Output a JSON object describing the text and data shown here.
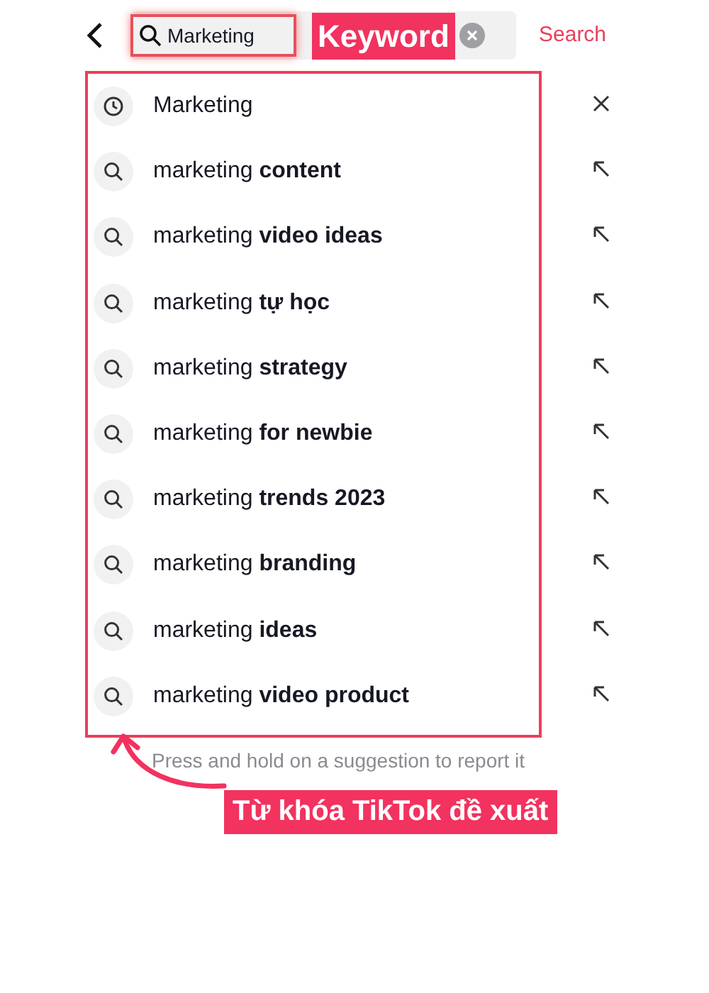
{
  "search_bar": {
    "value": "Marketing",
    "action": "Search"
  },
  "annotations": {
    "keyword_label": "Keyword",
    "suggestions_label": "Từ khóa TikTok đề xuất"
  },
  "suggestions": [
    {
      "kind": "history",
      "text": "Marketing"
    },
    {
      "kind": "suggestion",
      "text": "marketing **content**"
    },
    {
      "kind": "suggestion",
      "text": "marketing **video ideas**"
    },
    {
      "kind": "suggestion",
      "text": "marketing **tự học**"
    },
    {
      "kind": "suggestion",
      "text": "marketing **strategy**"
    },
    {
      "kind": "suggestion",
      "text": "marketing **for newbie**"
    },
    {
      "kind": "suggestion",
      "text": "marketing **trends 2023**"
    },
    {
      "kind": "suggestion",
      "text": "marketing **branding**"
    },
    {
      "kind": "suggestion",
      "text": "marketing **ideas**"
    },
    {
      "kind": "suggestion",
      "text": "marketing **video product**"
    }
  ],
  "hint": "Press and hold on a suggestion to report it"
}
